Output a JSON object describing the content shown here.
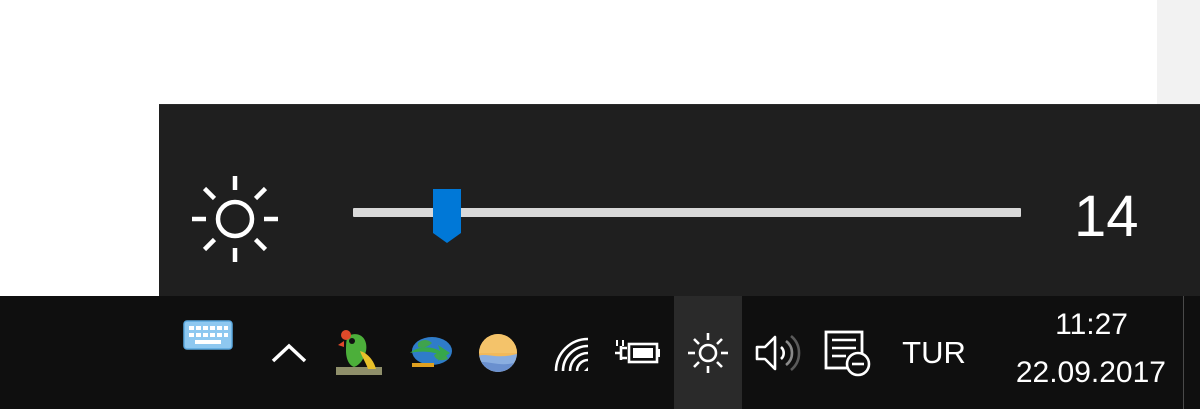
{
  "flyout": {
    "brightness_value": "14",
    "brightness_level": 14,
    "icon": "brightness-sun-icon",
    "accent": "#0078d7"
  },
  "taskbar": {
    "tray_icons": [
      "touch-keyboard-icon",
      "show-hidden-icons-chevron-icon",
      "parrot-app-icon",
      "download-manager-icon",
      "photos-app-icon",
      "wifi-icon",
      "battery-charging-icon",
      "brightness-icon",
      "volume-icon",
      "action-center-icon"
    ],
    "language": "TUR",
    "clock": {
      "time": "11:27",
      "date": "22.09.2017"
    }
  }
}
